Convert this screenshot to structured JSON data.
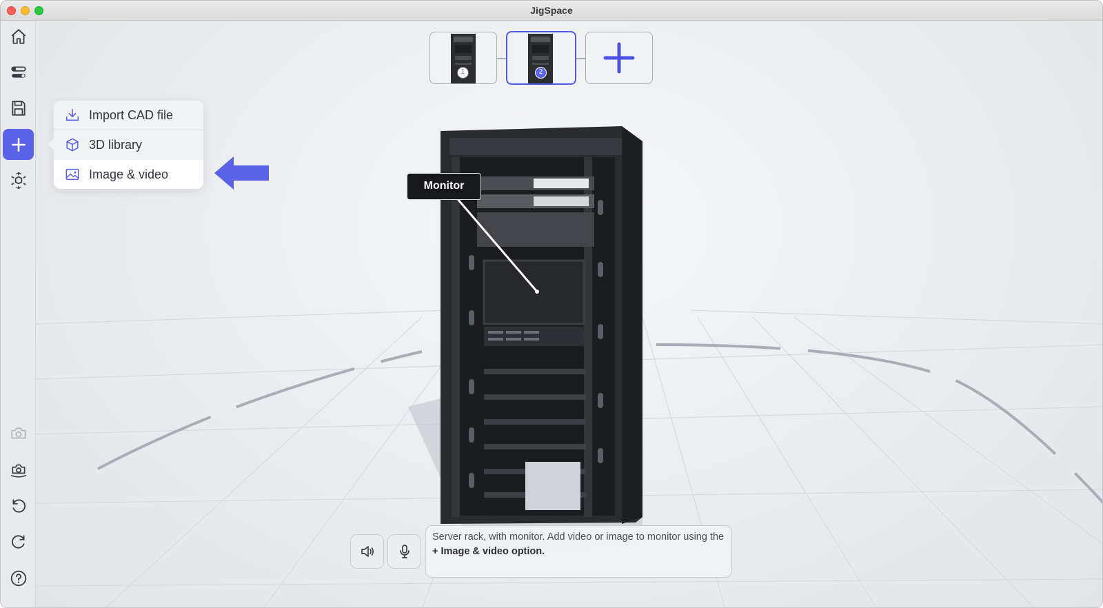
{
  "window": {
    "title": "JigSpace"
  },
  "sidebar": {
    "top_items": [
      {
        "icon": "home-icon"
      },
      {
        "icon": "toggles-icon"
      },
      {
        "icon": "save-icon"
      },
      {
        "icon": "plus-icon",
        "active": true
      },
      {
        "icon": "cube-explode-icon"
      }
    ],
    "bottom_items": [
      {
        "icon": "camera-view-icon",
        "disabled": true
      },
      {
        "icon": "camera-reset-icon"
      },
      {
        "icon": "undo-icon"
      },
      {
        "icon": "redo-icon"
      },
      {
        "icon": "help-icon"
      }
    ]
  },
  "steps": {
    "items": [
      {
        "number": "1",
        "selected": false
      },
      {
        "number": "2",
        "selected": true
      }
    ],
    "add_icon": "plus-icon"
  },
  "add_menu": {
    "items": [
      {
        "label": "Import CAD file",
        "icon": "download-icon"
      },
      {
        "label": "3D library",
        "icon": "cube-icon"
      },
      {
        "label": "Image & video",
        "icon": "image-icon",
        "highlighted": true
      }
    ]
  },
  "callout": {
    "icon": "arrow-left-icon",
    "color": "#5a62e8"
  },
  "scene": {
    "label": "Monitor"
  },
  "step_notes": {
    "text": "Server rack, with monitor. Add video or image to monitor using the ",
    "bold": "+ Image & video option."
  },
  "colors": {
    "accent": "#5a62e8",
    "selected_border": "#5258e6"
  }
}
